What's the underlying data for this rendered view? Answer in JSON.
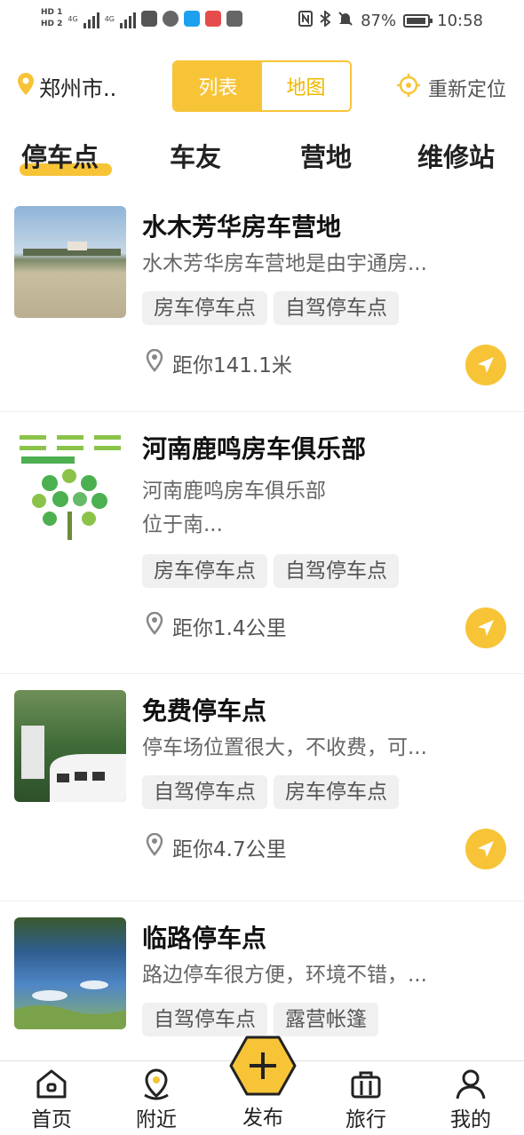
{
  "status_bar": {
    "hd1": "HD 1",
    "hd2": "HD 2",
    "net1": "4G",
    "net2": "4G",
    "battery_percent": "87%",
    "time": "10:58",
    "icons": [
      "nfc-icon",
      "bluetooth-icon",
      "mute-icon",
      "battery-icon"
    ]
  },
  "header": {
    "city": "郑州市..",
    "view_tabs": [
      {
        "label": "列表",
        "active": true
      },
      {
        "label": "地图",
        "active": false
      }
    ],
    "relocate_label": "重新定位",
    "accent_color": "#f7c438"
  },
  "category_tabs": [
    {
      "label": "停车点",
      "active": true
    },
    {
      "label": "车友",
      "active": false
    },
    {
      "label": "营地",
      "active": false
    },
    {
      "label": "维修站",
      "active": false
    }
  ],
  "list": [
    {
      "title": "水木芳华房车营地",
      "desc": "水木芳华房车营地是由宇通房...",
      "tags": [
        "房车停车点",
        "自驾停车点"
      ],
      "distance": "距你141.1米"
    },
    {
      "title": "河南鹿鸣房车俱乐部",
      "desc_line1": "河南鹿鸣房车俱乐部",
      "desc_line2": "位于南...",
      "tags": [
        "房车停车点",
        "自驾停车点"
      ],
      "distance": "距你1.4公里"
    },
    {
      "title": "免费停车点",
      "desc": "停车场位置很大，不收费，可...",
      "tags": [
        "自驾停车点",
        "房车停车点"
      ],
      "distance": "距你4.7公里"
    },
    {
      "title": "临路停车点",
      "desc": "路边停车很方便，环境不错，...",
      "tags": [
        "自驾停车点",
        "露营帐篷"
      ]
    }
  ],
  "bottom_nav": [
    {
      "label": "首页",
      "icon": "home-icon"
    },
    {
      "label": "附近",
      "icon": "location-pin-icon"
    },
    {
      "label": "发布",
      "icon": "plus-hexagon-icon"
    },
    {
      "label": "旅行",
      "icon": "briefcase-icon"
    },
    {
      "label": "我的",
      "icon": "user-icon"
    }
  ]
}
